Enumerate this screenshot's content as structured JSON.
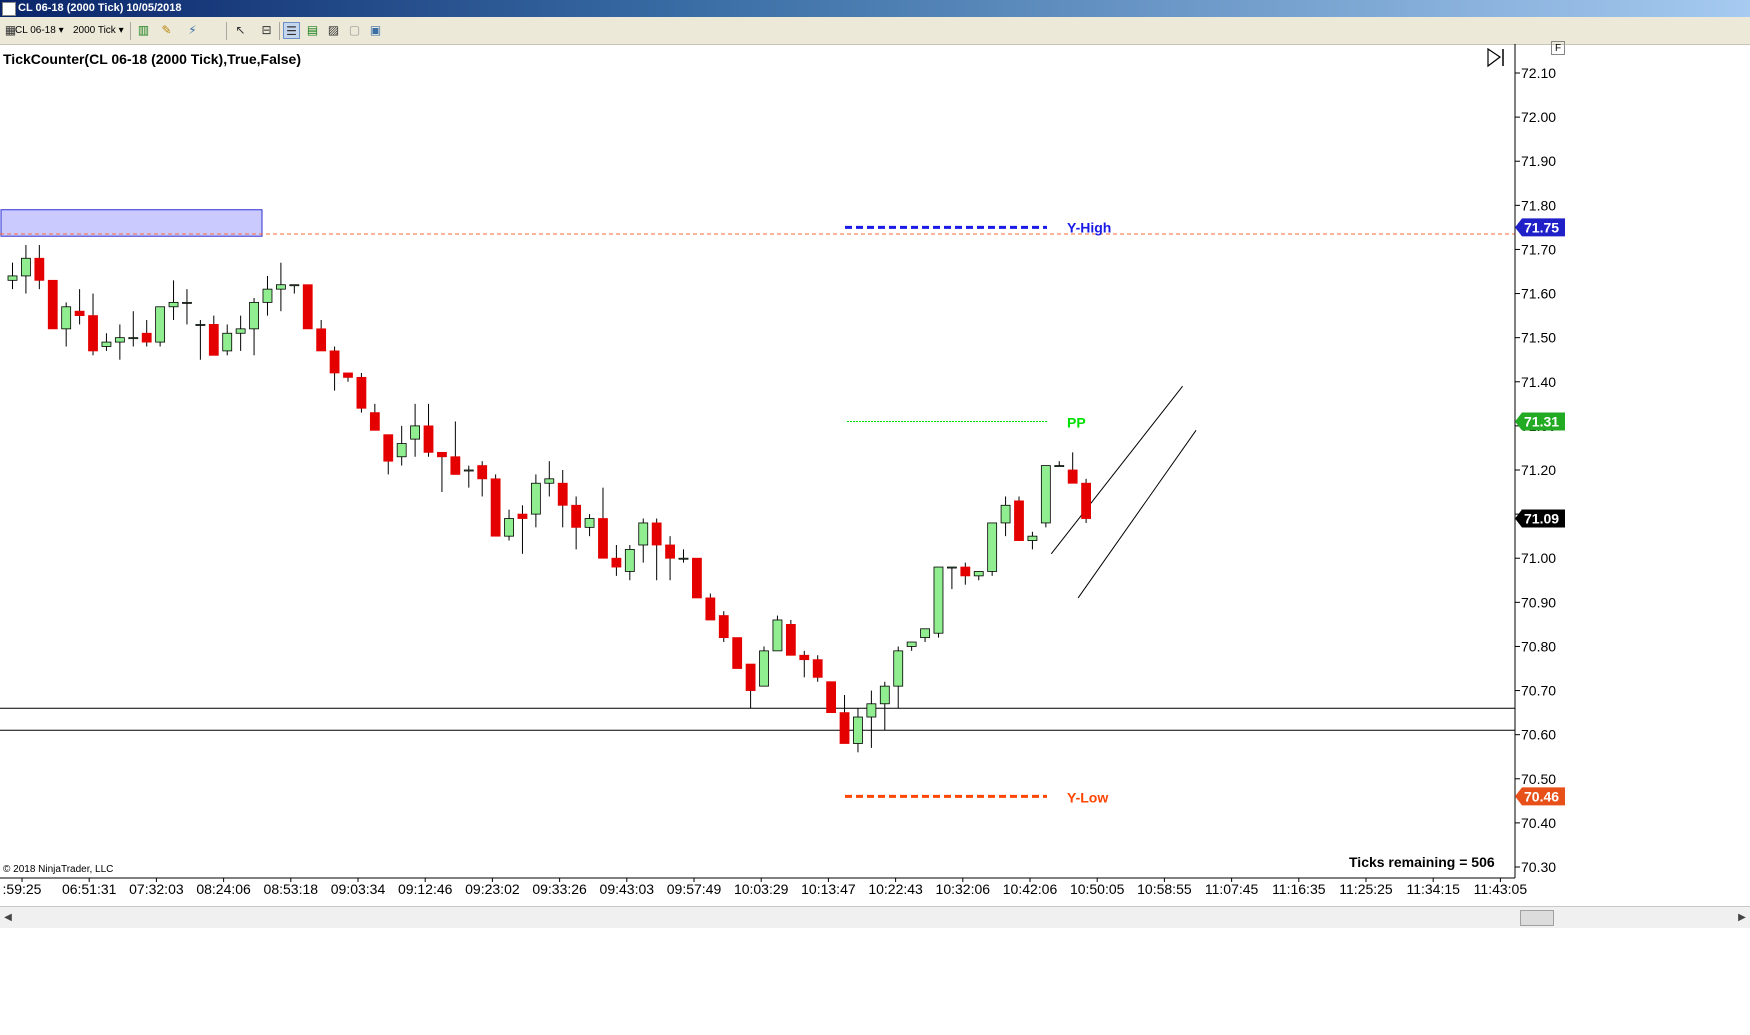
{
  "window": {
    "title": "CL 06-18 (2000 Tick)  10/05/2018"
  },
  "toolbar": {
    "instrument": "CL 06-18",
    "interval": "2000 Tick",
    "icons": [
      "bars-type-icon",
      "pencil-draw-icon",
      "wand-icon",
      "pointer-icon",
      "zoom-icon",
      "properties-icon",
      "indicators-icon",
      "strategies-icon",
      "alert-icon",
      "data-box-icon"
    ]
  },
  "chart": {
    "indicator_label": "TickCounter(CL 06-18 (2000 Tick),True,False)",
    "copyright": "© 2018 NinjaTrader, LLC",
    "ticks_remaining": "Ticks remaining = 506",
    "corner_button": "F",
    "colors": {
      "up": "#90ee90",
      "down": "#e50000",
      "yhigh": "#1a1ae6",
      "ylow": "#ff4500",
      "pp": "#00e000",
      "last": "#000000",
      "dashed_resistance": "#ff6a33"
    }
  },
  "chart_data": {
    "type": "candlestick",
    "ylim": [
      70.28,
      72.16
    ],
    "y_ticks": [
      "72.10",
      "72.00",
      "71.90",
      "71.80",
      "71.70",
      "71.60",
      "71.50",
      "71.40",
      "71.30",
      "71.20",
      "71.10",
      "71.00",
      "70.90",
      "70.80",
      "70.70",
      "70.60",
      "70.50",
      "70.40",
      "70.30"
    ],
    "x_ticks": [
      ":59:25",
      "06:51:31",
      "07:32:03",
      "08:24:06",
      "08:53:18",
      "09:03:34",
      "09:12:46",
      "09:23:02",
      "09:33:26",
      "09:43:03",
      "09:57:49",
      "10:03:29",
      "10:13:47",
      "10:22:43",
      "10:32:06",
      "10:42:06",
      "10:50:05",
      "10:58:55",
      "11:07:45",
      "11:16:35",
      "11:25:25",
      "11:34:15",
      "11:43:05"
    ],
    "candles": [
      {
        "o": 71.63,
        "h": 71.67,
        "l": 71.61,
        "c": 71.64
      },
      {
        "o": 71.64,
        "h": 71.71,
        "l": 71.6,
        "c": 71.68
      },
      {
        "o": 71.68,
        "h": 71.71,
        "l": 71.61,
        "c": 71.63
      },
      {
        "o": 71.63,
        "h": 71.63,
        "l": 71.52,
        "c": 71.52
      },
      {
        "o": 71.52,
        "h": 71.58,
        "l": 71.48,
        "c": 71.57
      },
      {
        "o": 71.56,
        "h": 71.61,
        "l": 71.53,
        "c": 71.55
      },
      {
        "o": 71.55,
        "h": 71.6,
        "l": 71.46,
        "c": 71.47
      },
      {
        "o": 71.48,
        "h": 71.51,
        "l": 71.47,
        "c": 71.49
      },
      {
        "o": 71.49,
        "h": 71.53,
        "l": 71.45,
        "c": 71.5
      },
      {
        "o": 71.5,
        "h": 71.56,
        "l": 71.48,
        "c": 71.5
      },
      {
        "o": 71.51,
        "h": 71.54,
        "l": 71.48,
        "c": 71.49
      },
      {
        "o": 71.49,
        "h": 71.57,
        "l": 71.48,
        "c": 71.57
      },
      {
        "o": 71.57,
        "h": 71.63,
        "l": 71.54,
        "c": 71.58
      },
      {
        "o": 71.58,
        "h": 71.61,
        "l": 71.53,
        "c": 71.58
      },
      {
        "o": 71.53,
        "h": 71.54,
        "l": 71.45,
        "c": 71.53
      },
      {
        "o": 71.53,
        "h": 71.55,
        "l": 71.48,
        "c": 71.46
      },
      {
        "o": 71.47,
        "h": 71.53,
        "l": 71.46,
        "c": 71.51
      },
      {
        "o": 71.51,
        "h": 71.55,
        "l": 71.47,
        "c": 71.52
      },
      {
        "o": 71.52,
        "h": 71.59,
        "l": 71.46,
        "c": 71.58
      },
      {
        "o": 71.58,
        "h": 71.64,
        "l": 71.55,
        "c": 71.61
      },
      {
        "o": 71.61,
        "h": 71.67,
        "l": 71.56,
        "c": 71.62
      },
      {
        "o": 71.62,
        "h": 71.62,
        "l": 71.6,
        "c": 71.62
      },
      {
        "o": 71.62,
        "h": 71.62,
        "l": 71.52,
        "c": 71.52
      },
      {
        "o": 71.52,
        "h": 71.54,
        "l": 71.47,
        "c": 71.47
      },
      {
        "o": 71.47,
        "h": 71.48,
        "l": 71.38,
        "c": 71.42
      },
      {
        "o": 71.42,
        "h": 71.42,
        "l": 71.4,
        "c": 71.41
      },
      {
        "o": 71.41,
        "h": 71.42,
        "l": 71.33,
        "c": 71.34
      },
      {
        "o": 71.33,
        "h": 71.35,
        "l": 71.29,
        "c": 71.29
      },
      {
        "o": 71.28,
        "h": 71.28,
        "l": 71.19,
        "c": 71.22
      },
      {
        "o": 71.23,
        "h": 71.3,
        "l": 71.21,
        "c": 71.26
      },
      {
        "o": 71.27,
        "h": 71.35,
        "l": 71.23,
        "c": 71.3
      },
      {
        "o": 71.3,
        "h": 71.35,
        "l": 71.23,
        "c": 71.24
      },
      {
        "o": 71.24,
        "h": 71.24,
        "l": 71.15,
        "c": 71.23
      },
      {
        "o": 71.23,
        "h": 71.31,
        "l": 71.2,
        "c": 71.19
      },
      {
        "o": 71.2,
        "h": 71.21,
        "l": 71.16,
        "c": 71.2
      },
      {
        "o": 71.21,
        "h": 71.22,
        "l": 71.14,
        "c": 71.18
      },
      {
        "o": 71.18,
        "h": 71.19,
        "l": 71.05,
        "c": 71.05
      },
      {
        "o": 71.05,
        "h": 71.11,
        "l": 71.04,
        "c": 71.09
      },
      {
        "o": 71.1,
        "h": 71.12,
        "l": 71.01,
        "c": 71.09
      },
      {
        "o": 71.1,
        "h": 71.19,
        "l": 71.07,
        "c": 71.17
      },
      {
        "o": 71.17,
        "h": 71.22,
        "l": 71.14,
        "c": 71.18
      },
      {
        "o": 71.17,
        "h": 71.2,
        "l": 71.07,
        "c": 71.12
      },
      {
        "o": 71.12,
        "h": 71.14,
        "l": 71.02,
        "c": 71.07
      },
      {
        "o": 71.07,
        "h": 71.1,
        "l": 71.05,
        "c": 71.09
      },
      {
        "o": 71.09,
        "h": 71.16,
        "l": 71.0,
        "c": 71.0
      },
      {
        "o": 71.0,
        "h": 71.03,
        "l": 70.96,
        "c": 70.98
      },
      {
        "o": 70.97,
        "h": 71.03,
        "l": 70.95,
        "c": 71.02
      },
      {
        "o": 71.03,
        "h": 71.09,
        "l": 70.99,
        "c": 71.08
      },
      {
        "o": 71.08,
        "h": 71.09,
        "l": 70.95,
        "c": 71.03
      },
      {
        "o": 71.03,
        "h": 71.05,
        "l": 70.95,
        "c": 71.0
      },
      {
        "o": 71.0,
        "h": 71.02,
        "l": 70.99,
        "c": 71.0
      },
      {
        "o": 71.0,
        "h": 71.0,
        "l": 70.91,
        "c": 70.91
      },
      {
        "o": 70.91,
        "h": 70.92,
        "l": 70.86,
        "c": 70.86
      },
      {
        "o": 70.87,
        "h": 70.88,
        "l": 70.81,
        "c": 70.82
      },
      {
        "o": 70.82,
        "h": 70.82,
        "l": 70.75,
        "c": 70.75
      },
      {
        "o": 70.76,
        "h": 70.76,
        "l": 70.66,
        "c": 70.7
      },
      {
        "o": 70.71,
        "h": 70.8,
        "l": 70.71,
        "c": 70.79
      },
      {
        "o": 70.79,
        "h": 70.87,
        "l": 70.79,
        "c": 70.86
      },
      {
        "o": 70.85,
        "h": 70.86,
        "l": 70.78,
        "c": 70.78
      },
      {
        "o": 70.78,
        "h": 70.79,
        "l": 70.73,
        "c": 70.77
      },
      {
        "o": 70.77,
        "h": 70.78,
        "l": 70.72,
        "c": 70.73
      },
      {
        "o": 70.72,
        "h": 70.72,
        "l": 70.65,
        "c": 70.65
      },
      {
        "o": 70.65,
        "h": 70.69,
        "l": 70.58,
        "c": 70.58
      },
      {
        "o": 70.58,
        "h": 70.66,
        "l": 70.56,
        "c": 70.64
      },
      {
        "o": 70.64,
        "h": 70.7,
        "l": 70.57,
        "c": 70.67
      },
      {
        "o": 70.67,
        "h": 70.72,
        "l": 70.61,
        "c": 70.71
      },
      {
        "o": 70.71,
        "h": 70.8,
        "l": 70.66,
        "c": 70.79
      },
      {
        "o": 70.8,
        "h": 70.81,
        "l": 70.79,
        "c": 70.81
      },
      {
        "o": 70.82,
        "h": 70.84,
        "l": 70.81,
        "c": 70.84
      },
      {
        "o": 70.83,
        "h": 70.98,
        "l": 70.82,
        "c": 70.98
      },
      {
        "o": 70.98,
        "h": 70.98,
        "l": 70.93,
        "c": 70.98
      },
      {
        "o": 70.98,
        "h": 70.99,
        "l": 70.94,
        "c": 70.96
      },
      {
        "o": 70.96,
        "h": 70.97,
        "l": 70.95,
        "c": 70.97
      },
      {
        "o": 70.97,
        "h": 71.08,
        "l": 70.96,
        "c": 71.08
      },
      {
        "o": 71.08,
        "h": 71.14,
        "l": 71.05,
        "c": 71.12
      },
      {
        "o": 71.13,
        "h": 71.14,
        "l": 71.04,
        "c": 71.04
      },
      {
        "o": 71.04,
        "h": 71.06,
        "l": 71.02,
        "c": 71.05
      },
      {
        "o": 71.08,
        "h": 71.21,
        "l": 71.07,
        "c": 71.21
      },
      {
        "o": 71.21,
        "h": 71.22,
        "l": 71.21,
        "c": 71.21
      },
      {
        "o": 71.2,
        "h": 71.24,
        "l": 71.17,
        "c": 71.17
      },
      {
        "o": 71.17,
        "h": 71.18,
        "l": 71.08,
        "c": 71.09
      }
    ],
    "horizontal_lines": [
      {
        "name": "Y-High",
        "value": 71.75,
        "label": "Y-High",
        "badge": "71.75"
      },
      {
        "name": "PP",
        "value": 71.31,
        "label": "PP",
        "badge": "71.31"
      },
      {
        "name": "Y-Low",
        "value": 70.46,
        "label": "Y-Low",
        "badge": "70.46"
      },
      {
        "name": "last",
        "value": 71.09,
        "badge": "71.09"
      },
      {
        "name": "resistance-dashed",
        "value": 71.735
      },
      {
        "name": "support-upper",
        "value": 70.66
      },
      {
        "name": "support-lower",
        "value": 70.61
      }
    ],
    "zone": {
      "from": 71.73,
      "to": 71.79
    },
    "channel": [
      {
        "start": [
          78,
          71.01
        ],
        "end": [
          86,
          71.39
        ]
      },
      {
        "start": [
          80,
          70.91
        ],
        "end": [
          87,
          71.29
        ]
      }
    ]
  }
}
